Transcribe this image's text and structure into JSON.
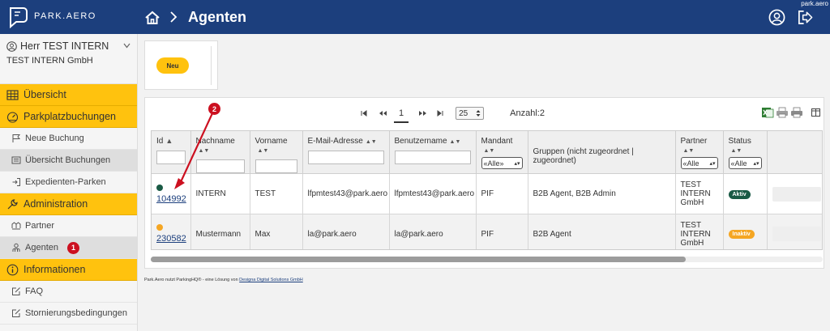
{
  "corner": {
    "text": "park.aero"
  },
  "brand": {
    "name": "PARK.AERO"
  },
  "header": {
    "title": "Agenten"
  },
  "user": {
    "name": "Herr TEST INTERN",
    "company": "TEST INTERN GmbH"
  },
  "nav": {
    "uebersicht": "Übersicht",
    "parkplatzbuchungen": "Parkplatzbuchungen",
    "neue_buchung": "Neue Buchung",
    "uebersicht_buchungen": "Übersicht Buchungen",
    "expedienten_parken": "Expedienten-Parken",
    "administration": "Administration",
    "partner": "Partner",
    "agenten": "Agenten",
    "agenten_badge": "1",
    "informationen": "Informationen",
    "faq": "FAQ",
    "storno": "Stornierungsbedingungen"
  },
  "toolbar": {
    "new_label": "Neu"
  },
  "pager": {
    "page": "1",
    "page_size": "25",
    "count": "Anzahl:2"
  },
  "table": {
    "headers": {
      "id": "Id",
      "nachname": "Nachname",
      "vorname": "Vorname",
      "email": "E-Mail-Adresse",
      "benutzername": "Benutzername",
      "mandant": "Mandant",
      "mandant_filter": "«Alle»",
      "gruppen": "Gruppen (nicht zugeordnet | zugeordnet)",
      "partner": "Partner",
      "partner_filter": "«Alle",
      "status": "Status",
      "status_filter": "«Alle"
    },
    "rows": [
      {
        "id": "104992",
        "dot_color": "#1a5a45",
        "nachname": "INTERN",
        "vorname": "TEST",
        "email": "lfpmtest43@park.aero",
        "benutzername": "lfpmtest43@park.aero",
        "mandant": "PIF",
        "gruppen": "B2B Agent, B2B Admin",
        "partner": "TEST INTERN GmbH",
        "status": "Aktiv",
        "status_color": "#1a5a45"
      },
      {
        "id": "230582",
        "dot_color": "#f5a623",
        "nachname": "Mustermann",
        "vorname": "Max",
        "email": "la@park.aero",
        "benutzername": "la@park.aero",
        "mandant": "PIF",
        "gruppen": "B2B Agent",
        "partner": "TEST INTERN GmbH",
        "status": "Inaktiv",
        "status_color": "#f5a623"
      }
    ]
  },
  "annotation": {
    "marker": "2"
  },
  "footer": {
    "text": "Park.Aero nutzt ParkingHQ® - eine Lösung von ",
    "link": "Designa Digital Solutions GmbH"
  },
  "colors": {
    "header": "#1c3f7d",
    "accent": "#ffc20e",
    "badge": "#cc1020"
  }
}
